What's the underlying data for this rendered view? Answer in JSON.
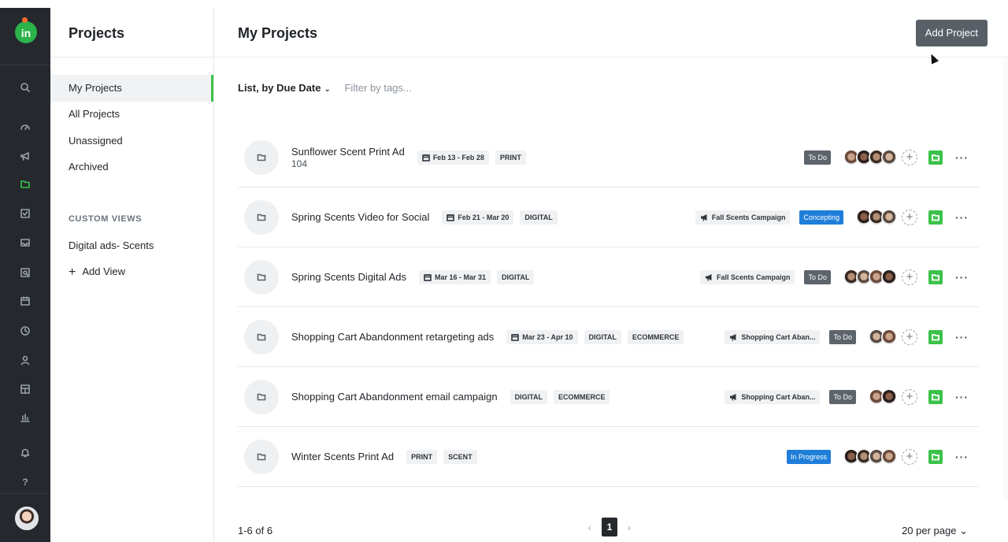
{
  "colors": {
    "rail_bg": "#25292e",
    "accent_green": "#3cc24a",
    "todo": "#5d646c",
    "concepting": "#1f7ed9",
    "in_progress": "#1f7ed9"
  },
  "rail": {
    "logo": "in",
    "icons": [
      "search-icon",
      "dashboard-icon",
      "megaphone-icon",
      "folder-icon",
      "checkbox-icon",
      "inbox-icon",
      "proofing-icon",
      "calendar-icon",
      "clock-icon",
      "person-icon",
      "board-icon",
      "reports-icon",
      "bell-icon",
      "help-icon"
    ]
  },
  "sidebar": {
    "title": "Projects",
    "items": [
      {
        "label": "My Projects",
        "active": true
      },
      {
        "label": "All Projects"
      },
      {
        "label": "Unassigned"
      },
      {
        "label": "Archived"
      }
    ],
    "section_label": "CUSTOM VIEWS",
    "custom_views": [
      {
        "label": "Digital ads- Scents"
      }
    ],
    "add_view_label": "Add View"
  },
  "main": {
    "title": "My Projects",
    "add_button": "Add Project",
    "view_selector": "List, by Due Date",
    "filter_placeholder": "Filter by tags..."
  },
  "projects": [
    {
      "title": "Sunflower Scent Print Ad",
      "subtitle": "104",
      "date": "Feb 13 - Feb 28",
      "tags": [
        "PRINT"
      ],
      "campaign": "",
      "status": "To Do",
      "status_kind": "todo",
      "avatars": 4
    },
    {
      "title": "Spring Scents Video for Social",
      "subtitle": "",
      "date": "Feb 21 - Mar 20",
      "tags": [
        "DIGITAL"
      ],
      "campaign": "Fall Scents Campaign",
      "status": "Concepting",
      "status_kind": "concepting",
      "avatars": 3
    },
    {
      "title": "Spring Scents Digital Ads",
      "subtitle": "",
      "date": "Mar 16 - Mar 31",
      "tags": [
        "DIGITAL"
      ],
      "campaign": "Fall Scents Campaign",
      "status": "To Do",
      "status_kind": "todo",
      "avatars": 4
    },
    {
      "title": "Shopping Cart Abandonment retargeting ads",
      "subtitle": "",
      "date": "Mar 23 - Apr 10",
      "tags": [
        "DIGITAL",
        "ECOMMERCE"
      ],
      "campaign": "Shopping Cart Aban...",
      "status": "To Do",
      "status_kind": "todo",
      "avatars": 2
    },
    {
      "title": "Shopping Cart Abandonment email campaign",
      "subtitle": "",
      "date": "",
      "tags": [
        "DIGITAL",
        "ECOMMERCE"
      ],
      "campaign": "Shopping Cart Aban...",
      "status": "To Do",
      "status_kind": "todo",
      "avatars": 2
    },
    {
      "title": "Winter Scents Print Ad",
      "subtitle": "",
      "date": "",
      "tags": [
        "PRINT",
        "SCENT"
      ],
      "campaign": "",
      "status": "In Progress",
      "status_kind": "in_progress",
      "avatars": 4
    }
  ],
  "footer": {
    "range": "1-6 of 6",
    "page": "1",
    "per_page": "20 per page"
  }
}
